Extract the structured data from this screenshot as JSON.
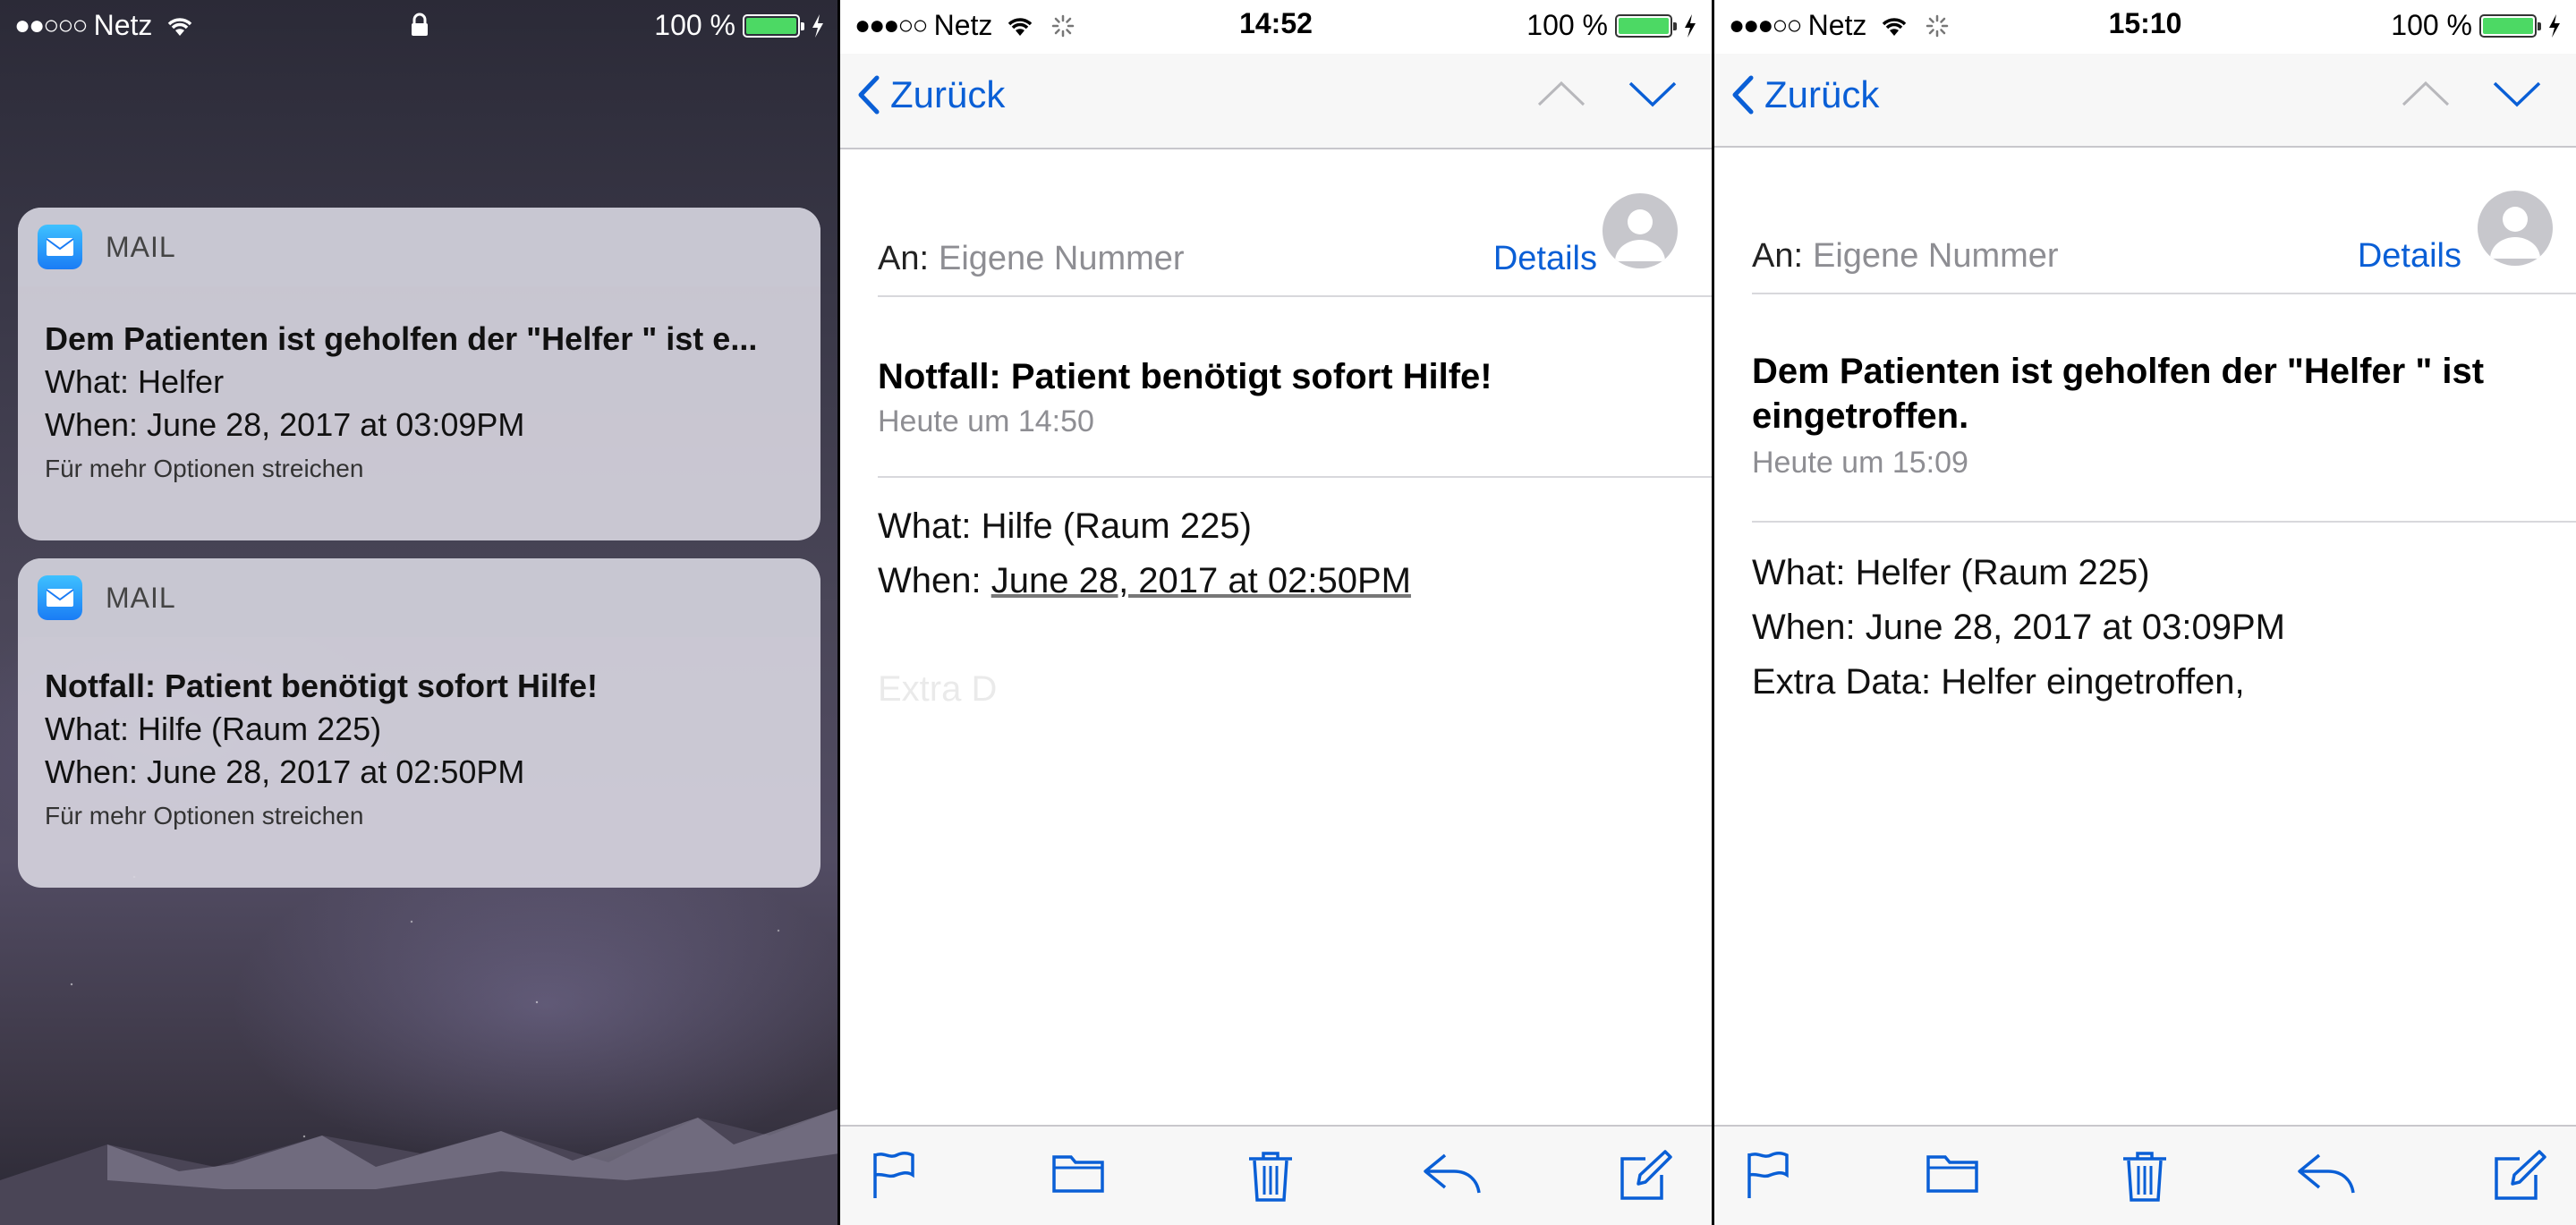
{
  "lockscreen": {
    "status": {
      "carrier": "Netz",
      "battery": "100 %"
    },
    "notifications": [
      {
        "app": "MAIL",
        "title": "Dem Patienten ist geholfen der \"Helfer \" ist e...",
        "what": "What: Helfer",
        "when": "When: June 28, 2017 at 03:09PM",
        "hint": "Für mehr Optionen streichen"
      },
      {
        "app": "MAIL",
        "title": "Notfall: Patient benötigt sofort Hilfe!",
        "what": "What: Hilfe (Raum 225)",
        "when": "When: June 28, 2017 at 02:50PM",
        "hint": "Für mehr Optionen streichen"
      }
    ]
  },
  "mail1": {
    "status": {
      "carrier": "Netz",
      "time": "14:52",
      "battery": "100 %"
    },
    "back_label": "Zurück",
    "to_label": "An:",
    "to_value": "Eigene Nummer",
    "details_label": "Details",
    "subject": "Notfall: Patient benötigt sofort Hilfe!",
    "date": "Heute um 14:50",
    "body_what": "What: Hilfe (Raum 225)",
    "body_when_label": "When: ",
    "body_when_value": "June 28, 2017 at 02:50PM",
    "ghost_text": "Extra D"
  },
  "mail2": {
    "status": {
      "carrier": "Netz",
      "time": "15:10",
      "battery": "100 %"
    },
    "back_label": "Zurück",
    "to_label": "An:",
    "to_value": "Eigene Nummer",
    "details_label": "Details",
    "subject": "Dem Patienten ist geholfen der \"Helfer \" ist eingetroffen.",
    "date": "Heute um 15:09",
    "body_what": "What: Helfer  (Raum 225)",
    "body_when": "When: June 28, 2017 at 03:09PM",
    "body_extra": "Extra Data: Helfer eingetroffen,"
  },
  "colors": {
    "ios_blue": "#0a5fd6",
    "battery_green": "#4cd964",
    "mail_icon": "#1a7cf5"
  }
}
